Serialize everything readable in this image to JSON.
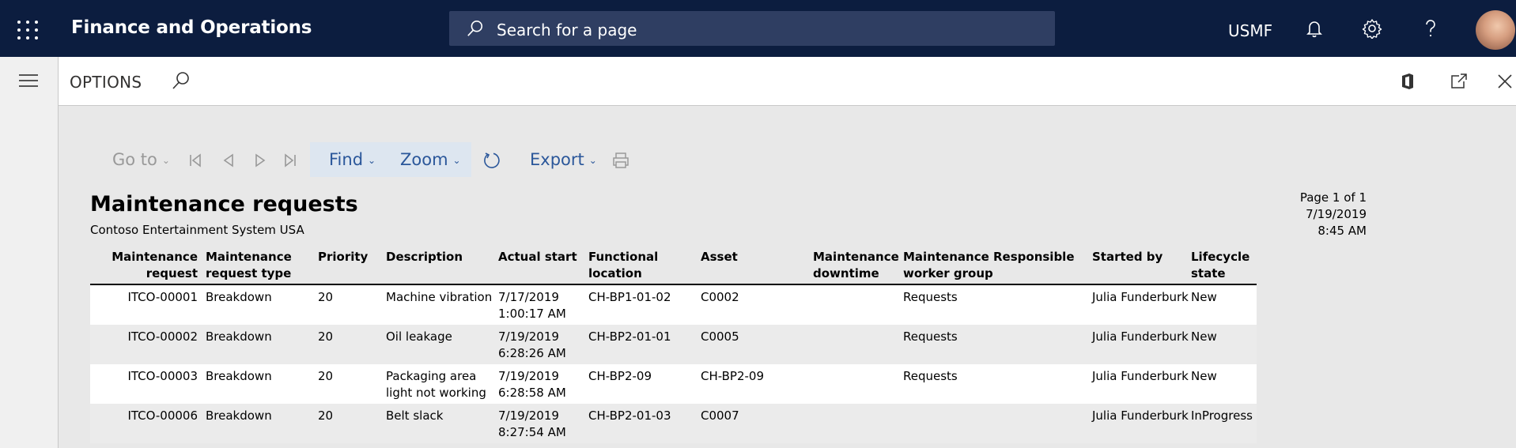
{
  "app": {
    "title": "Finance and Operations",
    "company": "USMF"
  },
  "search": {
    "placeholder": "Search for a page"
  },
  "options": {
    "title": "OPTIONS"
  },
  "toolbar": {
    "goto": "Go to",
    "find": "Find",
    "zoom": "Zoom",
    "export": "Export"
  },
  "report": {
    "title": "Maintenance requests",
    "subtitle": "Contoso Entertainment System USA",
    "page": "Page 1 of 1",
    "date": "7/19/2019",
    "time": "8:45 AM",
    "columns": [
      {
        "l1": "Maintenance",
        "l2": "request"
      },
      {
        "l1": "Maintenance",
        "l2": "request type"
      },
      {
        "l1": "Priority",
        "l2": ""
      },
      {
        "l1": "Description",
        "l2": ""
      },
      {
        "l1": "Actual start",
        "l2": ""
      },
      {
        "l1": "Functional",
        "l2": "location"
      },
      {
        "l1": "Asset",
        "l2": ""
      },
      {
        "l1": "Maintenance",
        "l2": "downtime"
      },
      {
        "l1": "Maintenance",
        "l2": "worker group"
      },
      {
        "l1": "Responsible",
        "l2": ""
      },
      {
        "l1": "Started by",
        "l2": ""
      },
      {
        "l1": "Lifecycle",
        "l2": "state"
      }
    ],
    "rows": [
      {
        "request": "ITCO-00001",
        "type": "Breakdown",
        "priority": "20",
        "desc1": "Machine vibration",
        "desc2": "",
        "start1": "7/17/2019",
        "start2": "1:00:17 AM",
        "location": "CH-BP1-01-02",
        "asset": "C0002",
        "downtime": "",
        "group": "Requests",
        "responsible": "",
        "started_by": "Julia Funderburk",
        "state": "New"
      },
      {
        "request": "ITCO-00002",
        "type": "Breakdown",
        "priority": "20",
        "desc1": "Oil leakage",
        "desc2": "",
        "start1": "7/19/2019",
        "start2": "6:28:26 AM",
        "location": "CH-BP2-01-01",
        "asset": "C0005",
        "downtime": "",
        "group": "Requests",
        "responsible": "",
        "started_by": "Julia Funderburk",
        "state": "New"
      },
      {
        "request": "ITCO-00003",
        "type": "Breakdown",
        "priority": "20",
        "desc1": "Packaging area",
        "desc2": "light not working",
        "start1": "7/19/2019",
        "start2": "6:28:58 AM",
        "location": "CH-BP2-09",
        "asset": "CH-BP2-09",
        "downtime": "",
        "group": "Requests",
        "responsible": "",
        "started_by": "Julia Funderburk",
        "state": "New"
      },
      {
        "request": "ITCO-00006",
        "type": "Breakdown",
        "priority": "20",
        "desc1": "Belt slack",
        "desc2": "",
        "start1": "7/19/2019",
        "start2": "8:27:54 AM",
        "location": "CH-BP2-01-03",
        "asset": "C0007",
        "downtime": "",
        "group": "",
        "responsible": "",
        "started_by": "Julia Funderburk",
        "state": "InProgress"
      }
    ]
  }
}
